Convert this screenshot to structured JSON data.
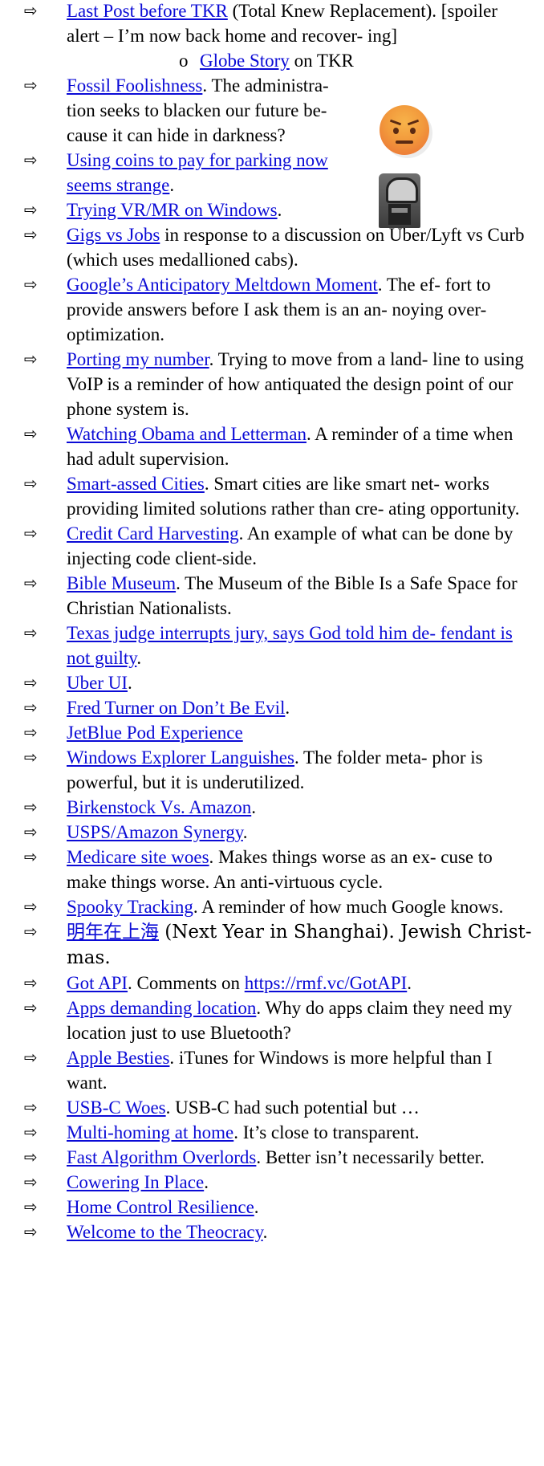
{
  "arrow_glyph": "⇨",
  "colors": {
    "link": "#0b0bd6",
    "text": "#000000"
  },
  "images": {
    "angry_emoji": "angry-face-emoji",
    "parking_meter": "parking-meter-photo"
  },
  "items": [
    {
      "link": "Last Post before TKR",
      "text": " (Total Knew Replacement). [spoiler alert – I’m now back home and recover- ing]",
      "sub": {
        "bullet": "o",
        "link": "Globe Story",
        "text": " on TKR"
      }
    },
    {
      "link": "Fossil Foolishness",
      "text": ". The administra- tion seeks to blacken our future be- cause it can hide in darkness?"
    },
    {
      "link": "Using coins to pay for parking now seems strange",
      "text": "."
    },
    {
      "link": "Trying VR/MR on Windows",
      "text": "."
    },
    {
      "link": "Gigs vs Jobs",
      "text": " in response to a discussion on Uber/Lyft vs Curb (which uses medallioned cabs)."
    },
    {
      "link": "Google’s Anticipatory Meltdown Moment",
      "text": ". The ef- fort to provide answers before I ask them is an an- noying over-optimization."
    },
    {
      "link": "Porting my number",
      "text": ". Trying to move from a land- line to using VoIP is a reminder of how antiquated the design point of our phone system is."
    },
    {
      "link": "Watching Obama and Letterman",
      "text": ". A reminder of a time when had adult supervision."
    },
    {
      "link": "Smart-assed Cities",
      "text": ". Smart cities are like smart net- works providing limited solutions rather than cre- ating opportunity."
    },
    {
      "link": "Credit Card Harvesting",
      "text": ". An example of what can be done by injecting code client-side."
    },
    {
      "link": "Bible Museum",
      "text": ". The Museum of the Bible Is a Safe Space for Christian Nationalists."
    },
    {
      "link": "Texas judge interrupts jury, says God told him de- fendant is not guilty",
      "text": "."
    },
    {
      "link": "Uber UI",
      "text": "."
    },
    {
      "link": "Fred Turner on Don’t Be Evil",
      "text": "."
    },
    {
      "link": "JetBlue Pod Experience",
      "text": ""
    },
    {
      "link": "Windows Explorer Languishes",
      "text": ". The folder meta- phor is powerful, but it is underutilized."
    },
    {
      "link": "Birkenstock Vs. Amazon",
      "text": "."
    },
    {
      "link": "USPS/Amazon Synergy",
      "text": "."
    },
    {
      "link": "Medicare site woes",
      "text": ". Makes things worse as an ex- cuse to make things worse. An anti-virtuous cycle."
    },
    {
      "link": "Spooky Tracking",
      "text": ". A reminder of how much Google knows."
    },
    {
      "link": "明年在上海",
      "text": " (Next Year in Shanghai). Jewish Christ- mas."
    },
    {
      "link": "Got API",
      "text": ". Comments on ",
      "link2": "https://rmf.vc/GotAPI",
      "text2": "."
    },
    {
      "link": "Apps demanding location",
      "text": ". Why do apps claim they need my location just to use Bluetooth?"
    },
    {
      "link": "Apple Besties",
      "text": ". iTunes for Windows is more helpful than I want."
    },
    {
      "link": "USB-C Woes",
      "text": ". USB-C had such potential but …"
    },
    {
      "link": "Multi-homing at home",
      "text": ". It’s close to transparent."
    },
    {
      "link": "Fast Algorithm Overlords",
      "text": ". Better isn’t necessarily better."
    },
    {
      "link": "Cowering In Place",
      "text": "."
    },
    {
      "link": "Home Control Resilience",
      "text": "."
    },
    {
      "link": "Welcome to the Theocracy",
      "text": "."
    }
  ]
}
